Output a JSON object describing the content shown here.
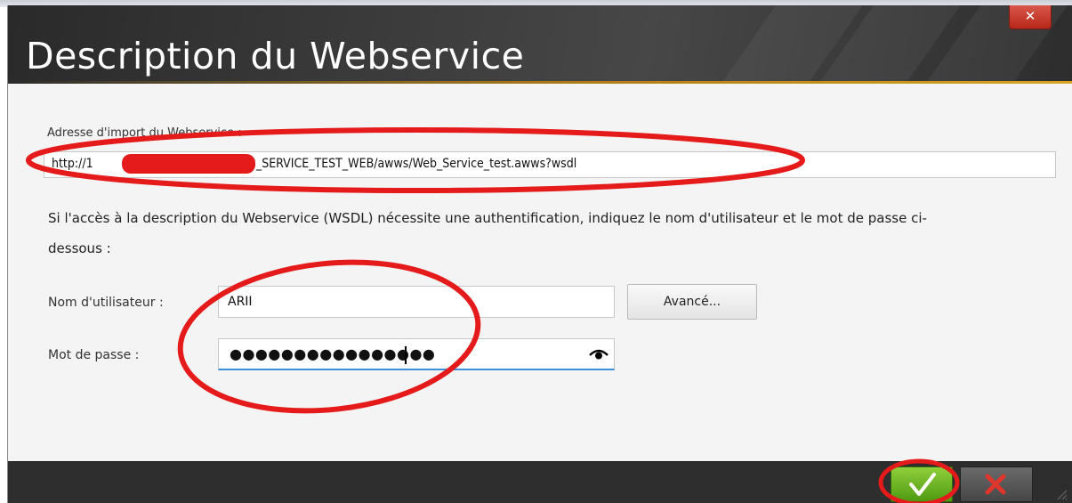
{
  "colors": {
    "header_bg": "#3b3b3b",
    "accent_gold": "#b07e14",
    "ok_green": "#5ba41a",
    "cancel_red": "#e0352a",
    "annotation_red": "#e51a1a",
    "focus_blue": "#3f8fd8"
  },
  "dialog": {
    "title": "Description du Webservice",
    "close_icon": "close-x-icon"
  },
  "import": {
    "label": "Adresse d'import du Webservice :",
    "url_prefix": "http://1",
    "url_suffix": "/WEB_SERVICE_TEST_WEB/awws/Web_Service_test.awws?wsdl"
  },
  "info": {
    "text": "Si l'accès à la description du Webservice (WSDL) nécessite une authentification, indiquez le nom d'utilisateur et le mot de passe ci-dessous :"
  },
  "auth": {
    "username_label": "Nom d'utilisateur :",
    "username_value": "ARII",
    "password_label": "Mot de passe :",
    "password_mask": "●●●●●●●●●●●●●●●●",
    "password_icon": "eye-icon",
    "advanced_label": "Avancé..."
  },
  "footer": {
    "ok_icon": "checkmark-icon",
    "cancel_icon": "cross-icon"
  }
}
